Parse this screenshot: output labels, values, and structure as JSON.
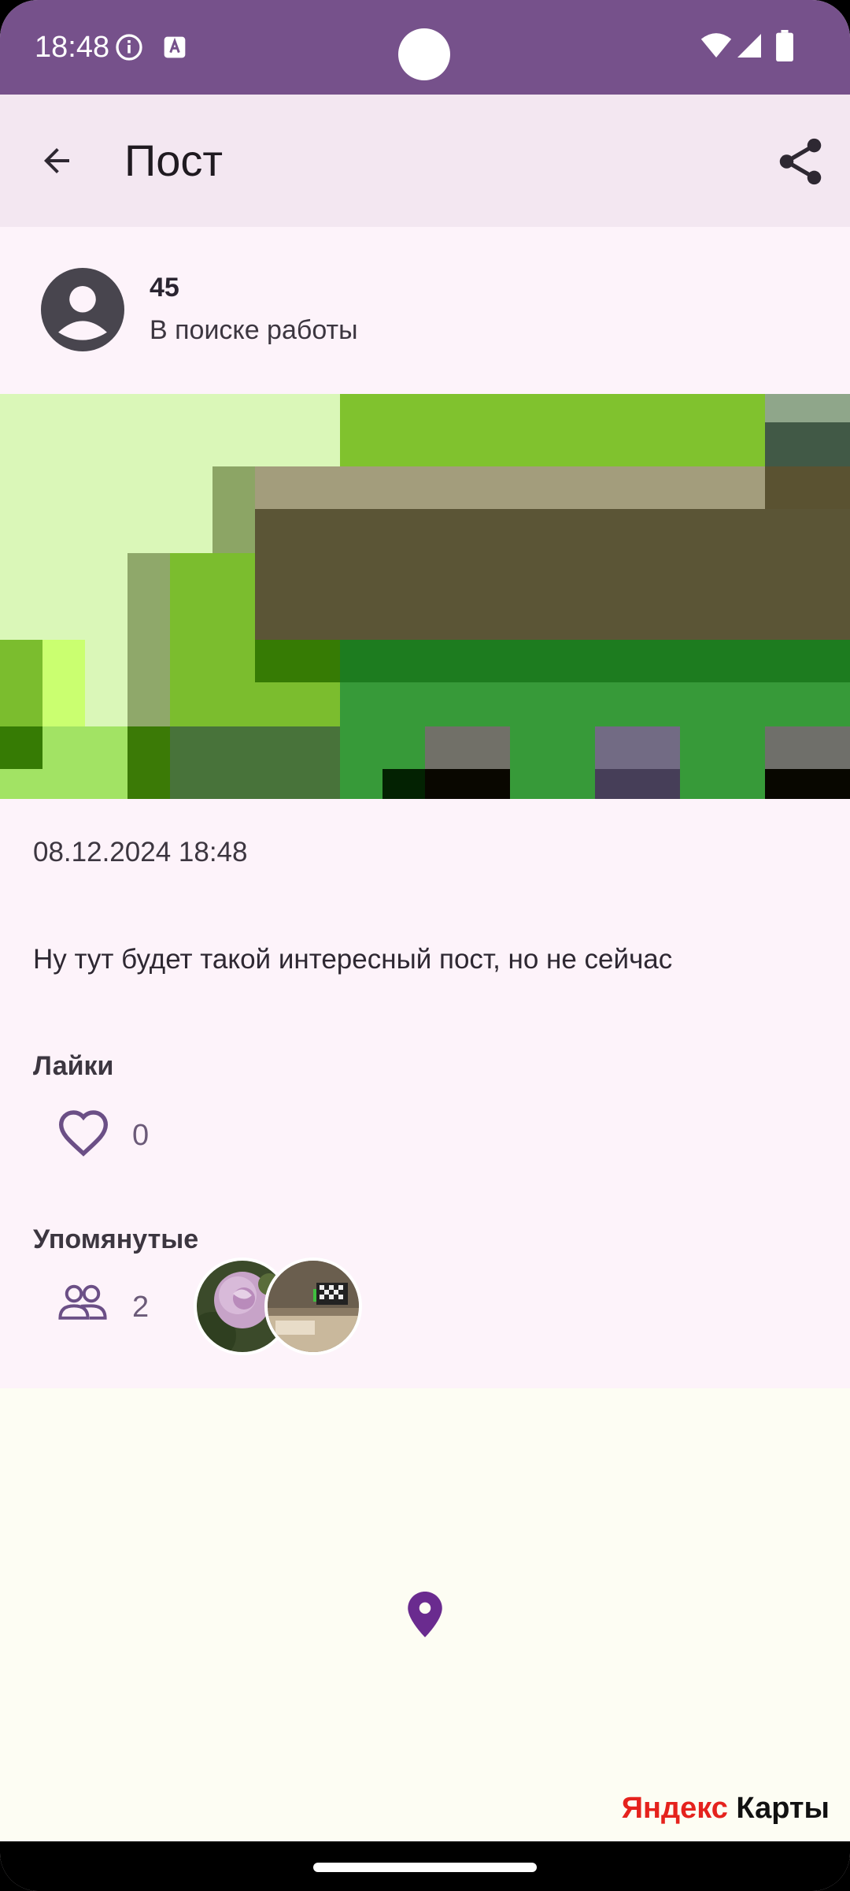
{
  "status_bar": {
    "time": "18:48",
    "icons": [
      "info-icon",
      "a-icon",
      "wifi-icon",
      "signal-icon",
      "battery-icon"
    ]
  },
  "app_bar": {
    "title": "Пост",
    "back_icon": "arrow-back-icon",
    "share_icon": "share-icon"
  },
  "author": {
    "name": "45",
    "status": "В поиске работы"
  },
  "post": {
    "date": "08.12.2024 18:48",
    "text": "Ну тут будет такой интересный пост, но не сейчас"
  },
  "likes": {
    "title": "Лайки",
    "count": "0"
  },
  "mentions": {
    "title": "Упомянутые",
    "count": "2"
  },
  "map": {
    "logo_ya": "Яндекс",
    "logo_rest": " Карты"
  },
  "colors": {
    "accent": "#76518b",
    "background": "#fdf3fa",
    "appbar": "#f3e7f1"
  }
}
